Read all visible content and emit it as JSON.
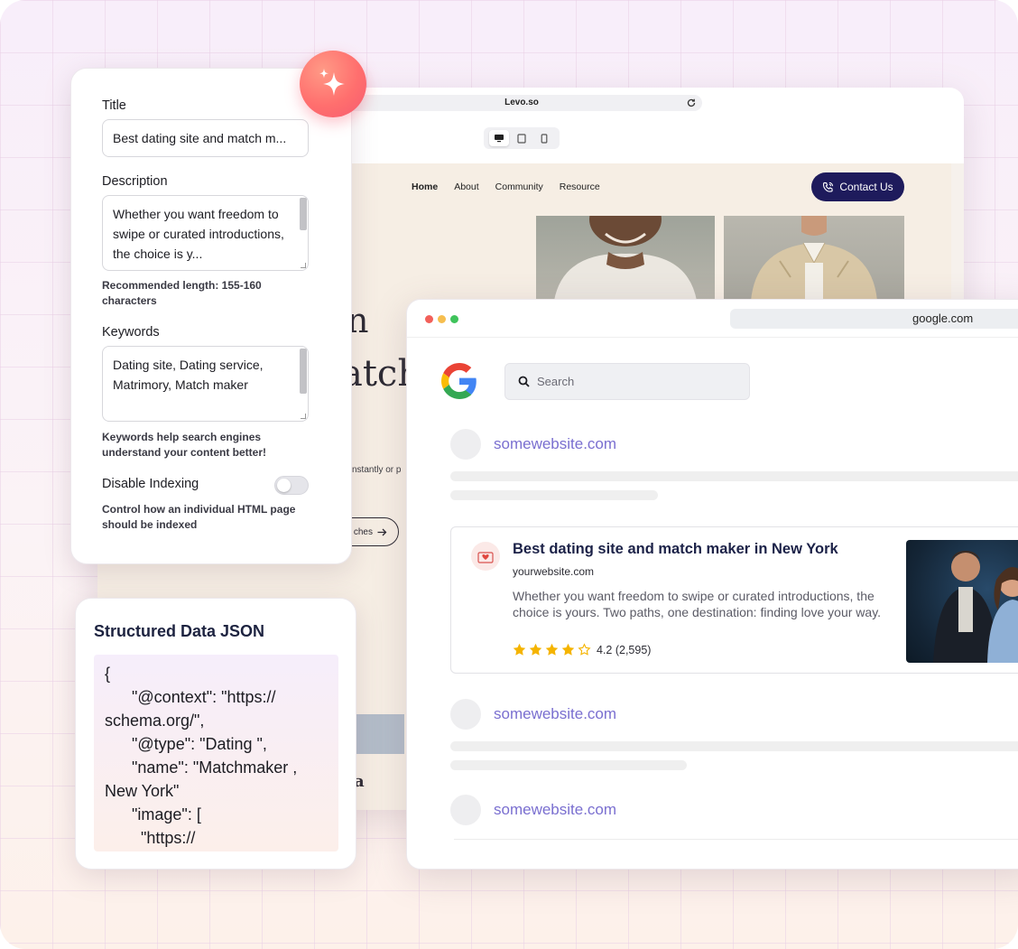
{
  "levo": {
    "address": "Levo.so",
    "nav": [
      "Home",
      "About",
      "Community",
      "Resource"
    ],
    "contact_label": "Contact Us",
    "hero_fragment_1": "n",
    "hero_fragment_2": "atch",
    "body_fragment": "nstantly or p",
    "cta_fragment": "ches",
    "footer_fragment": "a"
  },
  "seo": {
    "title_label": "Title",
    "title_value": "Best dating site and match m...",
    "description_label": "Description",
    "description_value": "Whether you want freedom to swipe or curated introductions, the choice is y...",
    "description_helper": "Recommended length: 155-160 characters",
    "keywords_label": "Keywords",
    "keywords_value": "Dating site, Dating service, Matrimory, Match maker",
    "keywords_helper": "Keywords help search engines understand your content better!",
    "indexing_label": "Disable Indexing",
    "indexing_enabled": false,
    "indexing_helper": "Control how an individual HTML page should be indexed"
  },
  "json_panel": {
    "title": "Structured Data JSON",
    "code": "{\n      \"@context\": \"https://\nschema.org/\",\n      \"@type\": \"Dating \",\n      \"name\": \"Matchmaker ,\nNew York\"\n      \"image\": [\n        \"https://"
  },
  "google": {
    "address": "google.com",
    "search_placeholder": "Search",
    "placeholder_site_1": "somewebsite.com",
    "placeholder_site_2": "somewebsite.com",
    "placeholder_site_3": "somewebsite.com",
    "result": {
      "title": "Best dating site and match maker in New York",
      "url": "yourwebsite.com",
      "description": "Whether you want freedom to swipe or curated introductions, the choice is yours. Two paths, one destination: finding love your way.",
      "rating": 4.2,
      "rating_text": "4.2 (2,595)"
    }
  },
  "colors": {
    "accent_navy": "#1e1b5c",
    "link_purple": "#7a6fd0",
    "star_gold": "#f5b400",
    "sparkle_coral": "#ff6f6e"
  }
}
